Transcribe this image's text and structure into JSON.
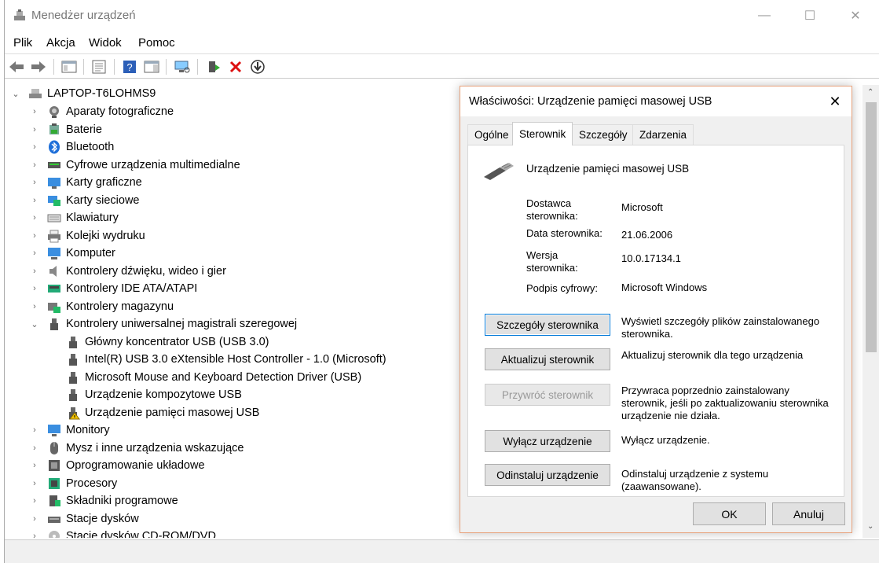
{
  "window": {
    "title": "Menedżer urządzeń",
    "minimize": "—",
    "maximize": "☐",
    "close": "✕"
  },
  "menu": [
    "Plik",
    "Akcja",
    "Widok",
    "Pomoc"
  ],
  "toolbar": [
    "back-icon",
    "forward-icon",
    "show-hide-tree-icon",
    "properties-icon",
    "help-icon",
    "action-pane-icon",
    "scan-hardware-icon",
    "update-driver-icon",
    "uninstall-icon",
    "disable-icon"
  ],
  "tree": {
    "root": "LAPTOP-T6LOHMS9",
    "categories": [
      {
        "label": "Aparaty fotograficzne",
        "icon": "camera-icon"
      },
      {
        "label": "Baterie",
        "icon": "battery-icon"
      },
      {
        "label": "Bluetooth",
        "icon": "bluetooth-icon"
      },
      {
        "label": "Cyfrowe urządzenia multimedialne",
        "icon": "media-device-icon"
      },
      {
        "label": "Karty graficzne",
        "icon": "display-adapter-icon"
      },
      {
        "label": "Karty sieciowe",
        "icon": "network-icon"
      },
      {
        "label": "Klawiatury",
        "icon": "keyboard-icon"
      },
      {
        "label": "Kolejki wydruku",
        "icon": "printer-icon"
      },
      {
        "label": "Komputer",
        "icon": "computer-icon"
      },
      {
        "label": "Kontrolery dźwięku, wideo i gier",
        "icon": "speaker-icon"
      },
      {
        "label": "Kontrolery IDE ATA/ATAPI",
        "icon": "ide-icon"
      },
      {
        "label": "Kontrolery magazynu",
        "icon": "storage-icon"
      },
      {
        "label": "Kontrolery uniwersalnej magistrali szeregowej",
        "icon": "usb-icon"
      }
    ],
    "usb_children": [
      {
        "label": "Główny koncentrator USB (USB 3.0)",
        "warning": false
      },
      {
        "label": "Intel(R) USB 3.0 eXtensible Host Controller - 1.0 (Microsoft)",
        "warning": false
      },
      {
        "label": "Microsoft Mouse and Keyboard Detection Driver (USB)",
        "warning": false
      },
      {
        "label": "Urządzenie kompozytowe USB",
        "warning": false
      },
      {
        "label": "Urządzenie pamięci masowej USB",
        "warning": true
      }
    ],
    "after": [
      {
        "label": "Monitory",
        "icon": "monitor-icon"
      },
      {
        "label": "Mysz i inne urządzenia wskazujące",
        "icon": "mouse-icon"
      },
      {
        "label": "Oprogramowanie układowe",
        "icon": "firmware-icon"
      },
      {
        "label": "Procesory",
        "icon": "processor-icon"
      },
      {
        "label": "Składniki programowe",
        "icon": "software-component-icon"
      },
      {
        "label": "Stacje dysków",
        "icon": "disk-drive-icon"
      },
      {
        "label": "Stacje dysków CD-ROM/DVD",
        "icon": "dvd-icon"
      }
    ]
  },
  "dialog": {
    "title": "Właściwości: Urządzenie pamięci masowej USB",
    "close": "✕",
    "tabs": [
      "Ogólne",
      "Sterownik",
      "Szczegóły",
      "Zdarzenia"
    ],
    "active_tab": "Sterownik",
    "device_name": "Urządzenie pamięci masowej USB",
    "props": [
      {
        "label": "Dostawca sterownika:",
        "value": "Microsoft"
      },
      {
        "label": "Data sterownika:",
        "value": "21.06.2006"
      },
      {
        "label": "Wersja sterownika:",
        "value": "10.0.17134.1"
      },
      {
        "label": "Podpis cyfrowy:",
        "value": "Microsoft Windows"
      }
    ],
    "actions": [
      {
        "button": "Szczegóły sterownika",
        "desc": "Wyświetl szczegóły plików zainstalowanego sterownika."
      },
      {
        "button": "Aktualizuj sterownik",
        "desc": "Aktualizuj sterownik dla tego urządzenia"
      },
      {
        "button": "Przywróć sterownik",
        "desc": "Przywraca poprzednio zainstalowany sterownik, jeśli po zaktualizowaniu sterownika urządzenie nie działa."
      },
      {
        "button": "Wyłącz urządzenie",
        "desc": "Wyłącz urządzenie."
      },
      {
        "button": "Odinstaluj urządzenie",
        "desc": "Odinstaluj urządzenie z systemu (zaawansowane)."
      }
    ],
    "ok": "OK",
    "cancel": "Anuluj"
  }
}
